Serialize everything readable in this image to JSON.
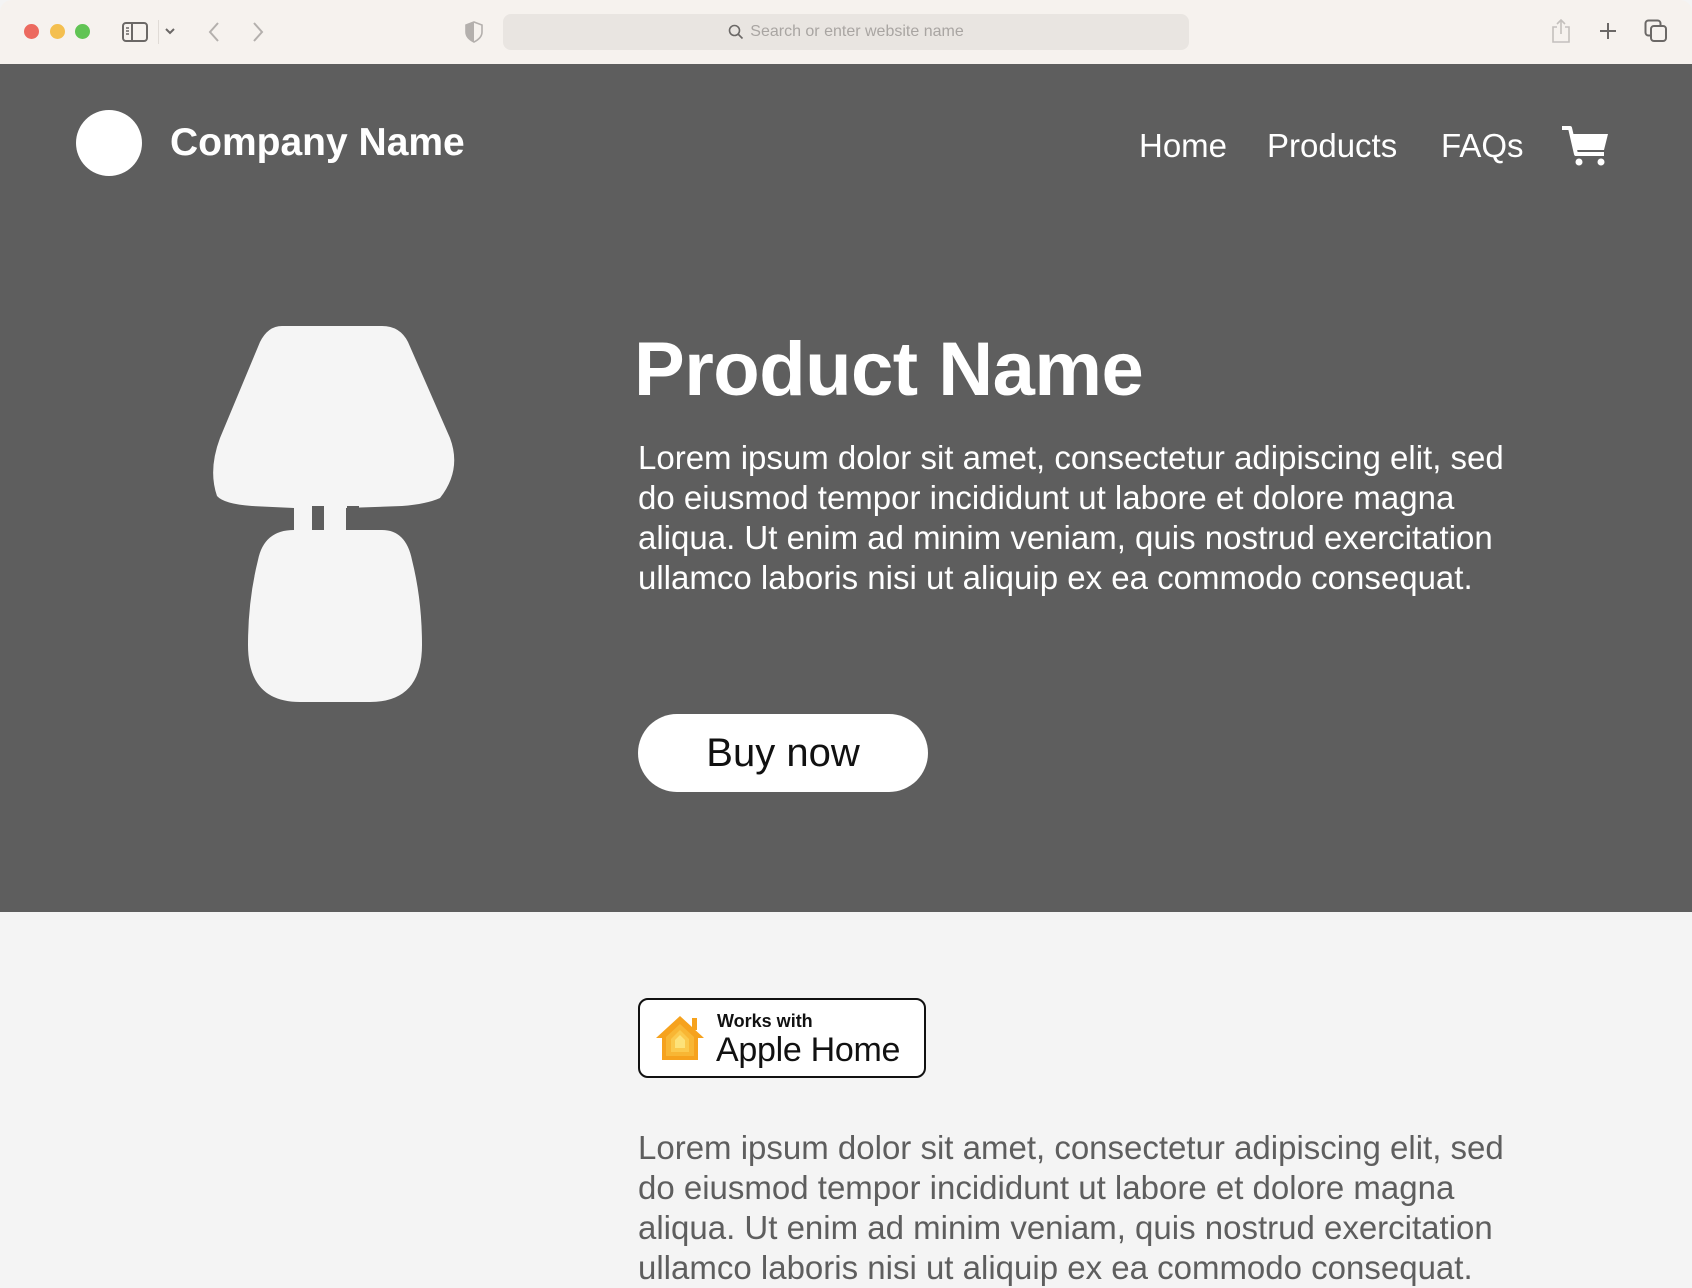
{
  "browser": {
    "address_placeholder": "Search or enter website name",
    "icons": [
      "sidebar-icon",
      "chevron-down-icon",
      "back-icon",
      "forward-icon",
      "privacy-shield-icon",
      "search-icon",
      "share-icon",
      "new-tab-icon",
      "tab-overview-icon"
    ]
  },
  "header": {
    "company_name": "Company Name",
    "nav": [
      {
        "label": "Home"
      },
      {
        "label": "Products"
      },
      {
        "label": "FAQs"
      }
    ],
    "cart_icon": "cart-icon"
  },
  "hero": {
    "image_icon": "lamp-icon",
    "title": "Product Name",
    "description": "Lorem ipsum dolor sit amet, consectetur adipiscing elit, sed do eiusmod tempor incididunt ut labore et dolore magna aliqua. Ut enim ad minim veniam, quis nostrud exercitation ullamco laboris nisi ut aliquip ex ea commodo consequat.",
    "buy_label": "Buy now"
  },
  "details": {
    "badge": {
      "small": "Works with",
      "big": "Apple Home",
      "icon": "home-icon"
    },
    "description": "Lorem ipsum dolor sit amet, consectetur adipiscing elit, sed do eiusmod tempor incididunt ut labore et dolore magna aliqua. Ut enim ad minim veniam, quis nostrud exercitation ullamco laboris nisi ut aliquip ex ea commodo consequat."
  },
  "colors": {
    "hero_bg": "#5e5e5e",
    "page_bg": "#f4f4f4",
    "toolbar_bg": "#f6f2ee"
  }
}
